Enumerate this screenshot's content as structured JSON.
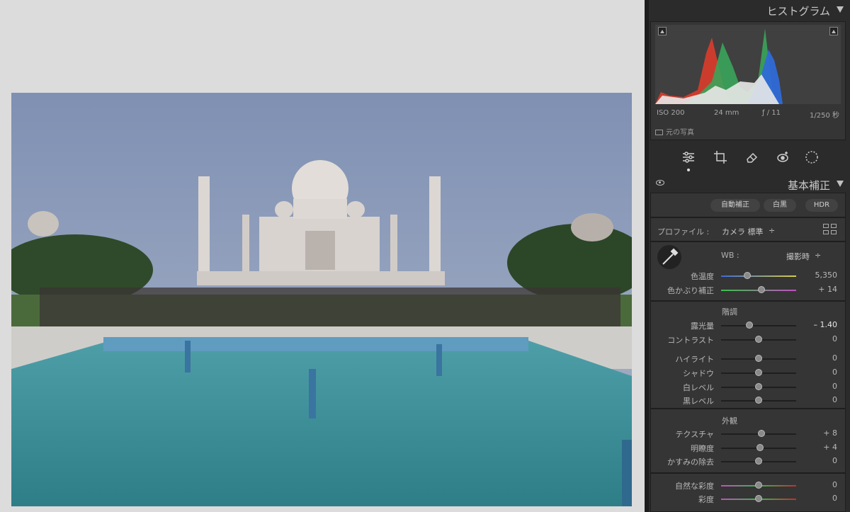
{
  "panel": {
    "histogram": {
      "title": "ヒストグラム",
      "iso": "ISO 200",
      "focal": "24 mm",
      "aperture": "ƒ / 11",
      "shutter": "1/250 秒",
      "original_photo_label": "元の写真"
    },
    "tools": [
      {
        "name": "edit-sliders-icon"
      },
      {
        "name": "crop-icon"
      },
      {
        "name": "healing-eraser-icon"
      },
      {
        "name": "red-eye-icon"
      },
      {
        "name": "masking-icon"
      }
    ],
    "basic": {
      "title": "基本補正",
      "auto_button": "自動補正",
      "bw_button": "白黒",
      "hdr_button": "HDR",
      "profile_label": "プロファイル :",
      "profile_value": "カメラ 標準",
      "profile_chevron": "÷",
      "wb_label": "WB :",
      "wb_value": "撮影時",
      "wb_chevron": "÷",
      "temp_label": "色温度",
      "temp_value": "5,350",
      "tint_label": "色かぶり補正",
      "tint_value": "+ 14",
      "tone_title": "階調",
      "exposure_label": "露光量",
      "exposure_value": "– 1.40",
      "contrast_label": "コントラスト",
      "contrast_value": "0",
      "highlights_label": "ハイライト",
      "highlights_value": "0",
      "shadows_label": "シャドウ",
      "shadows_value": "0",
      "whites_label": "白レベル",
      "whites_value": "0",
      "blacks_label": "黒レベル",
      "blacks_value": "0",
      "presence_title": "外観",
      "texture_label": "テクスチャ",
      "texture_value": "+ 8",
      "clarity_label": "明瞭度",
      "clarity_value": "+ 4",
      "dehaze_label": "かすみの除去",
      "dehaze_value": "0",
      "vibrance_label": "自然な彩度",
      "vibrance_value": "0",
      "saturation_label": "彩度",
      "saturation_value": "0"
    }
  },
  "sliders": {
    "temp": 0.35,
    "tint": 0.54,
    "exposure": 0.38,
    "contrast": 0.5,
    "highlights": 0.5,
    "shadows": 0.5,
    "whites": 0.5,
    "blacks": 0.5,
    "texture": 0.54,
    "clarity": 0.52,
    "dehaze": 0.5,
    "vibrance": 0.5,
    "saturation": 0.5
  },
  "colors": {
    "panel_bg": "#2b2b2b",
    "section_bg": "#353535",
    "histogram_red": "#d43c2c",
    "histogram_green": "#3aa45a",
    "histogram_blue": "#2f6ad8"
  }
}
